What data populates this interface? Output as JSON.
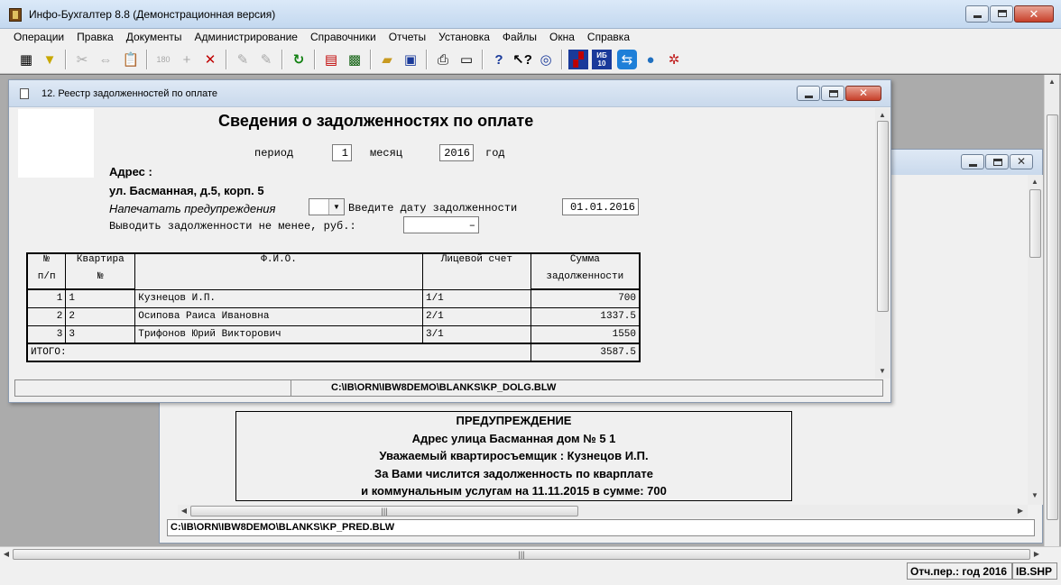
{
  "app": {
    "title": "Инфо-Бухгалтер 8.8 (Демонстрационная версия)"
  },
  "menu": [
    "Операции",
    "Правка",
    "Документы",
    "Администрирование",
    "Справочники",
    "Отчеты",
    "Установка",
    "Файлы",
    "Окна",
    "Справка"
  ],
  "toolbar_icons": [
    "grid-icon",
    "filter-icon",
    "cut-icon",
    "copy-icon",
    "paste-icon",
    "calc-180-icon",
    "plus-icon",
    "delete-icon",
    "pen-icon",
    "pen-disabled-icon",
    "refresh-icon",
    "document-icon",
    "calculator-icon",
    "open-folder-icon",
    "save-icon",
    "print-icon",
    "preview-icon",
    "help-icon",
    "context-help-icon",
    "compass-icon",
    "ms-icon",
    "ib10-icon",
    "teamviewer-icon",
    "globe-icon",
    "network-icon"
  ],
  "report_window": {
    "title": "12. Реестр задолженностей по оплате",
    "heading": "Сведения о задолженностях по оплате",
    "period_label": "период",
    "period_value": "1",
    "month_label": "месяц",
    "year_value": "2016",
    "year_label": "год",
    "address_label": "Адрес :",
    "address_value": "ул. Басманная, д.5, корп. 5",
    "print_warnings_label": "Напечатать предупреждения",
    "debt_date_label": "Введите дату задолженности",
    "debt_date_value": "01.01.2016",
    "min_debt_label": "Выводить задолженности не менее, руб.:",
    "min_debt_value": "–",
    "status_path": "C:\\IB\\ORN\\IBW8DEMO\\BLANKS\\KP_DOLG.BLW",
    "table": {
      "headers": {
        "num_top": "№",
        "num_bottom": "п/п",
        "apt_top": "Квартира",
        "apt_bottom": "№",
        "fio": "Ф.И.О.",
        "account": "Лицевой счет",
        "sum_top": "Сумма",
        "sum_bottom": "задолженности"
      },
      "rows": [
        {
          "n": "1",
          "apt": "1",
          "fio": "Кузнецов И.П.",
          "account": "1/1",
          "sum": "700"
        },
        {
          "n": "2",
          "apt": "2",
          "fio": "Осипова Раиса Ивановна",
          "account": "2/1",
          "sum": "1337.5"
        },
        {
          "n": "3",
          "apt": "3",
          "fio": "Трифонов Юрий Викторович",
          "account": "3/1",
          "sum": "1550"
        }
      ],
      "total_label": "ИТОГО:",
      "total_value": "3587.5"
    }
  },
  "warning_window": {
    "lines": [
      "ПРЕДУПРЕЖДЕНИЕ",
      "Адрес улица Басманная дом № 5 1",
      "Уважаемый квартиросъемщик : Кузнецов И.П.",
      "За Вами числится задолженность по кварплате",
      "и коммунальным услугам на 11.11.2015 в сумме: 700"
    ],
    "status_path": "C:\\IB\\ORN\\IBW8DEMO\\BLANKS\\KP_PRED.BLW"
  },
  "statusbar": {
    "period": "Отч.пер.: год 2016",
    "file": "IB.SHP"
  }
}
